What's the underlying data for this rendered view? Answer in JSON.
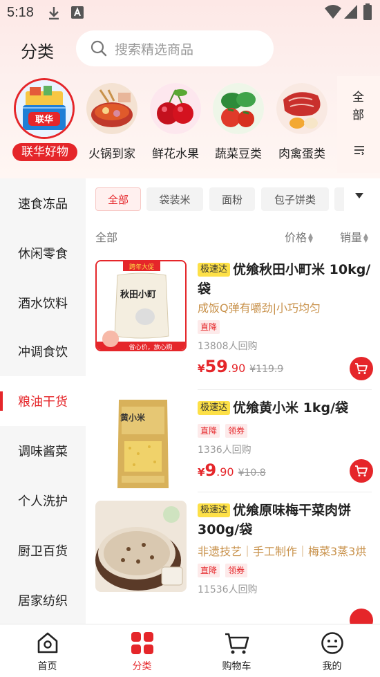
{
  "status": {
    "time": "5:18"
  },
  "header": {
    "title": "分类",
    "search_placeholder": "搜索精选商品"
  },
  "categories": [
    {
      "label": "联华好物",
      "badge": "联华",
      "active": true
    },
    {
      "label": "火锅到家"
    },
    {
      "label": "鲜花水果"
    },
    {
      "label": "蔬菜豆类"
    },
    {
      "label": "肉禽蛋类"
    }
  ],
  "all_categories_label": "全部",
  "sidebar": {
    "items": [
      {
        "label": "速食冻品"
      },
      {
        "label": "休闲零食"
      },
      {
        "label": "酒水饮料"
      },
      {
        "label": "冲调食饮"
      },
      {
        "label": "粮油干货",
        "active": true
      },
      {
        "label": "调味酱菜"
      },
      {
        "label": "个人洗护"
      },
      {
        "label": "厨卫百货"
      },
      {
        "label": "居家纺织"
      }
    ]
  },
  "chips": [
    {
      "label": "全部",
      "active": true
    },
    {
      "label": "袋装米"
    },
    {
      "label": "面粉"
    },
    {
      "label": "包子饼类"
    }
  ],
  "sort": {
    "all": "全部",
    "price": "价格",
    "sales": "销量"
  },
  "products": [
    {
      "badge": "极速达",
      "title": "优飨秋田小町米 10kg/袋",
      "desc": "成饭Q弹有嚼劲|小巧均匀",
      "tags": [
        "直降"
      ],
      "sold": "13808人回购",
      "price_symbol": "¥",
      "price_int": "59",
      "price_dec": ".90",
      "price_old": "¥119.9",
      "img_banner": "跨年大促",
      "img_brand": "秋田小町",
      "img_footer": "省心价，放心购"
    },
    {
      "badge": "极速达",
      "title": "优飨黄小米 1kg/袋",
      "desc": "",
      "tags": [
        "直降",
        "领券"
      ],
      "sold": "1336人回购",
      "price_symbol": "¥",
      "price_int": "9",
      "price_dec": ".90",
      "price_old": "¥10.8",
      "img_brand": "黄小米"
    },
    {
      "badge": "极速达",
      "title": "优飨原味梅干菜肉饼 300g/袋",
      "desc": "非遗技艺｜手工制作｜梅菜3蒸3烘",
      "tags": [
        "直降",
        "领券"
      ],
      "sold": "11536人回购"
    }
  ],
  "bottom_nav": [
    {
      "label": "首页",
      "icon": "home-icon"
    },
    {
      "label": "分类",
      "icon": "category-icon",
      "active": true
    },
    {
      "label": "购物车",
      "icon": "cart-icon"
    },
    {
      "label": "我的",
      "icon": "profile-icon"
    }
  ],
  "colors": {
    "accent": "#e5262a",
    "desc": "#c8914a",
    "fast_badge": "#fde047"
  }
}
